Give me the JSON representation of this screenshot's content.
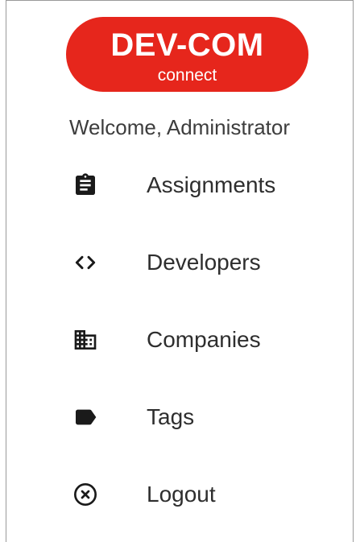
{
  "brand": {
    "title": "DEV-COM",
    "subtitle": "connect",
    "color": "#e6261c"
  },
  "welcome_text": "Welcome, Administrator",
  "nav": {
    "items": [
      {
        "label": "Assignments",
        "icon": "clipboard-icon"
      },
      {
        "label": "Developers",
        "icon": "code-icon"
      },
      {
        "label": "Companies",
        "icon": "building-icon"
      },
      {
        "label": "Tags",
        "icon": "tag-icon"
      },
      {
        "label": "Logout",
        "icon": "close-circle-icon"
      }
    ]
  }
}
